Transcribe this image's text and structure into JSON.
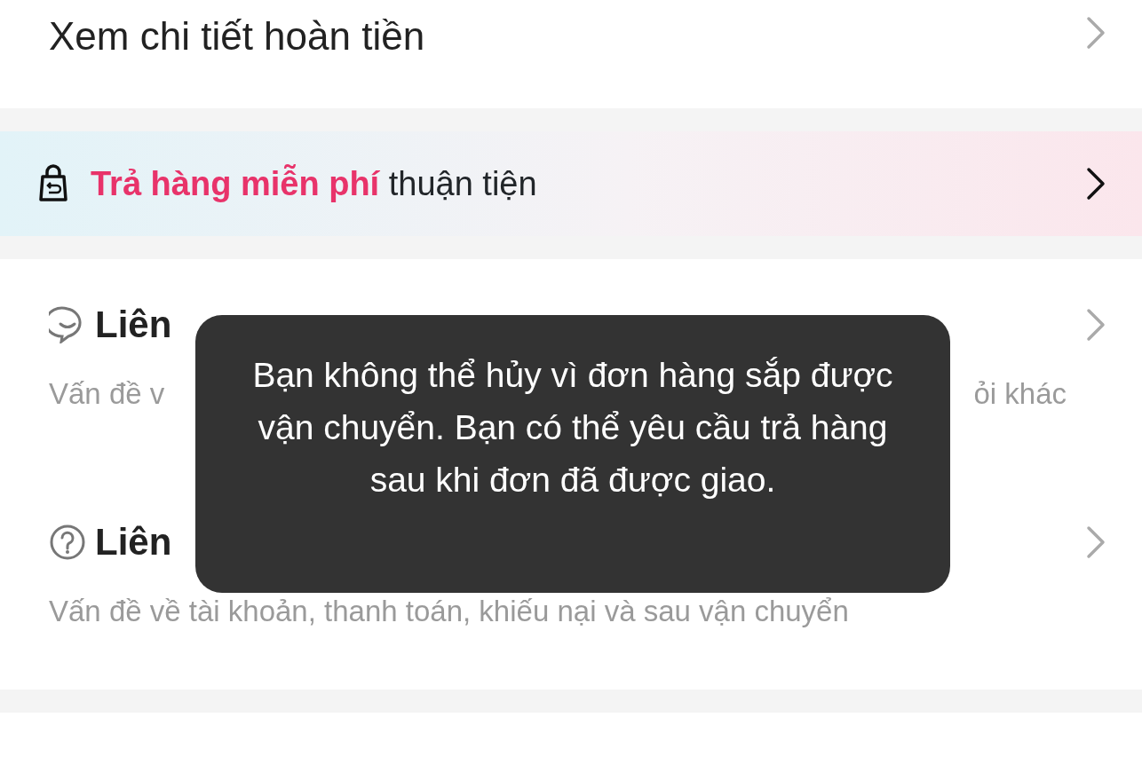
{
  "refund_row": {
    "label": "Xem chi tiết hoàn tiền"
  },
  "free_return_banner": {
    "highlight": "Trả hàng miễn phí",
    "text": "thuận tiện"
  },
  "contact_rows": [
    {
      "kind": "chat",
      "title": "Liên",
      "subtitle_parts": [
        "Vấn đề v",
        "ỏi khác"
      ]
    },
    {
      "kind": "help",
      "title": "Liên",
      "subtitle_parts": [
        "Vấn đề về tài khoản, thanh toán, khiếu nại và sau vận chuyển"
      ]
    }
  ],
  "toast": {
    "text": "Bạn không thể hủy vì đơn hàng sắp được vận chuyển. Bạn có thể yêu cầu trả hàng sau khi đơn đã được giao."
  }
}
